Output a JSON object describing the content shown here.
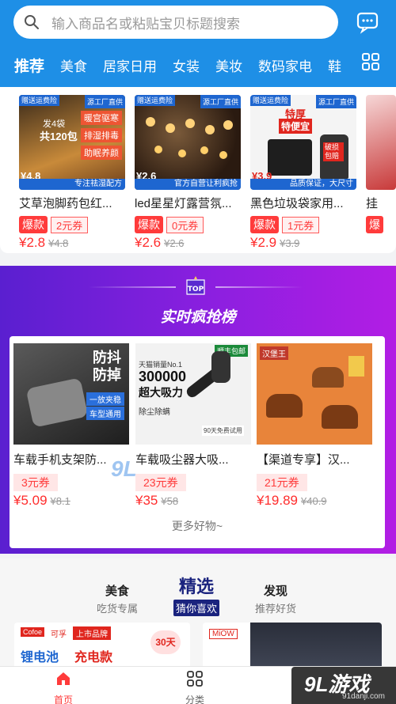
{
  "search": {
    "placeholder": "输入商品名或粘贴宝贝标题搜索"
  },
  "tabs": [
    "推荐",
    "美食",
    "居家日用",
    "女装",
    "美妆",
    "数码家电",
    "鞋"
  ],
  "products": [
    {
      "title": "艾草泡脚药包红...",
      "tag": "爆款",
      "coupon": "2元券",
      "price": "¥2.8",
      "old_price": "¥4.8",
      "img_price": "¥4.8",
      "ribbon": "赠送运费险",
      "ribbon2": "源工厂直供",
      "img_texts": [
        "发4袋",
        "共120包",
        "暖宫驱寒",
        "排湿排毒",
        "助眠养颜"
      ],
      "band": "专注祛湿配方"
    },
    {
      "title": "led星星灯露营氛...",
      "tag": "爆款",
      "coupon": "0元券",
      "price": "¥2.6",
      "old_price": "¥2.6",
      "img_price": "¥2.6",
      "ribbon": "赠送运费险",
      "ribbon2": "源工厂直供",
      "band": "官方自营让利疯抢"
    },
    {
      "title": "黑色垃圾袋家用...",
      "tag": "爆款",
      "coupon": "1元券",
      "price": "¥2.9",
      "old_price": "¥3.9",
      "img_price": "¥3.9",
      "ribbon": "赠送运费险",
      "ribbon2": "源工厂直供",
      "img_texts": [
        "特厚",
        "特便宜",
        "破损包赔"
      ],
      "band": "品质保证，大尺寸"
    },
    {
      "title": "挂",
      "tag": "爆"
    }
  ],
  "rank": {
    "badge": "TOP",
    "title": "实时疯抢榜",
    "more": "更多好物~",
    "items": [
      {
        "title": "车载手机支架防...",
        "coupon": "3元券",
        "price": "¥5.09",
        "old_price": "¥8.1",
        "img_texts": [
          "防抖",
          "防掉",
          "一放夹稳",
          "车型通用"
        ]
      },
      {
        "title": "车载吸尘器大吸...",
        "coupon": "23元券",
        "price": "¥35",
        "old_price": "¥58",
        "img_texts": [
          "天猫销量No.1",
          "300000",
          "超大吸力",
          "除尘除螨",
          "90天免费试用"
        ],
        "brand_tag": "顺丰包邮"
      },
      {
        "title": "【渠道专享】汉...",
        "coupon": "21元券",
        "price": "¥19.89",
        "old_price": "¥40.9",
        "img_texts": [
          "汉堡王"
        ]
      }
    ]
  },
  "selection_tabs": [
    {
      "main": "美食",
      "sub": "吃货专属",
      "active": false
    },
    {
      "main": "精选",
      "sub": "猜你喜欢",
      "active": true
    },
    {
      "main": "发现",
      "sub": "推荐好货",
      "active": false
    }
  ],
  "promos": [
    {
      "texts": [
        "Cofoe",
        "可孚",
        "上市品牌",
        "锂电池",
        "充电款",
        "30天"
      ]
    },
    {
      "texts": [
        "MiOW"
      ]
    }
  ],
  "bottom_nav": [
    {
      "label": "首页",
      "active": true
    },
    {
      "label": "分类",
      "active": false
    }
  ],
  "watermark": {
    "big": "9L游戏",
    "small": "91danji.com",
    "overlay": "9L"
  },
  "colors": {
    "header_blue": "#1e8fe6",
    "accent_red": "#ff3b3b",
    "rank_purple": "#8d1fe0",
    "selection_navy": "#1a237e"
  }
}
